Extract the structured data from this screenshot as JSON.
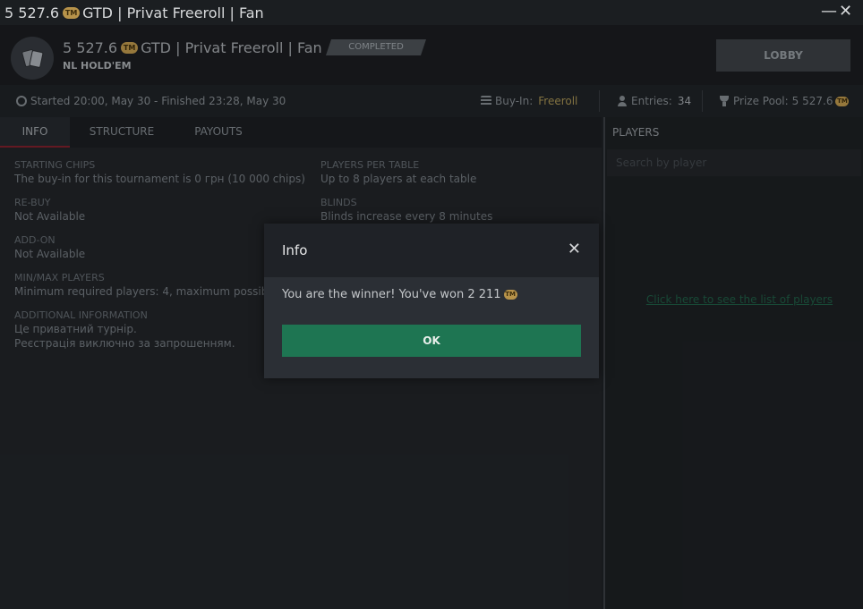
{
  "window": {
    "title_amount": "5 527.6",
    "title_rest": "GTD | Privat Freeroll | Fan",
    "minimize_glyph": "—",
    "close_glyph": "✕"
  },
  "header": {
    "title_amount": "5 527.6",
    "title_rest": "GTD | Privat Freeroll | Fan",
    "game_type": "NL HOLD'EM",
    "status_badge": "COMPLETED",
    "lobby_label": "LOBBY"
  },
  "coin_icon_text": "TM",
  "strip": {
    "schedule": "Started 20:00, May 30  -  Finished 23:28, May 30",
    "buyin_label": "Buy-In:",
    "buyin_value": "Freeroll",
    "entries_label": "Entries:",
    "entries_value": "34",
    "prize_label": "Prize Pool:",
    "prize_value": "5 527.6"
  },
  "tabs": [
    {
      "label": "INFO",
      "active": true
    },
    {
      "label": "STRUCTURE",
      "active": false
    },
    {
      "label": "PAYOUTS",
      "active": false
    }
  ],
  "info": {
    "starting_chips": {
      "label": "STARTING CHIPS",
      "value": "The buy-in for this tournament is 0 грн (10 000 chips)"
    },
    "rebuy": {
      "label": "RE-BUY",
      "value": "Not Available"
    },
    "addon": {
      "label": "ADD-ON",
      "value": "Not Available"
    },
    "minmax": {
      "label": "MIN/MAX PLAYERS",
      "value": "Minimum required players: 4, maximum possible:"
    },
    "additional": {
      "label": "ADDITIONAL INFORMATION",
      "line1": "Це приватний турнір.",
      "line2": "Реєстрація виключно за запрошенням."
    },
    "players_per_table": {
      "label": "PLAYERS PER TABLE",
      "value": "Up to 8 players at each table"
    },
    "blinds": {
      "label": "BLINDS",
      "value": "Blinds increase every 8 minutes"
    }
  },
  "players": {
    "header": "PLAYERS",
    "search_placeholder": "Search by player",
    "link": "Click here to see the list of players"
  },
  "dialog": {
    "title": "Info",
    "close_glyph": "✕",
    "message": "You are the winner! You've won 2 211",
    "ok_label": "OK"
  }
}
